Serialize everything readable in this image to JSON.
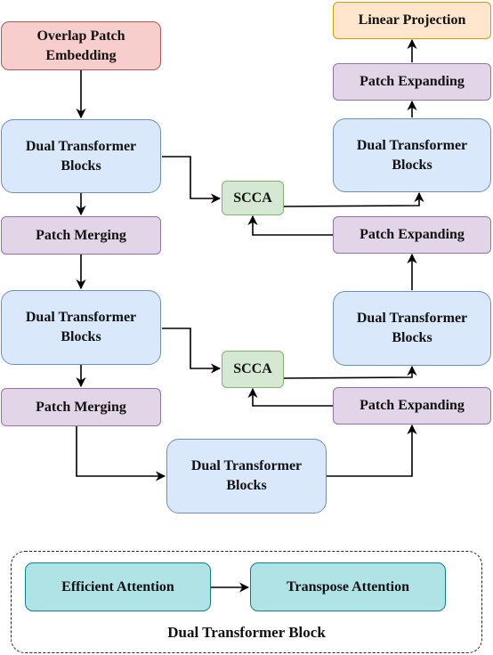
{
  "diagram": {
    "encoder": {
      "embedding": "Overlap Patch Embedding",
      "dtb1": "Dual Transformer Blocks",
      "merge1": "Patch Merging",
      "dtb2": "Dual Transformer Blocks",
      "merge2": "Patch Merging"
    },
    "bottleneck": "Dual Transformer Blocks",
    "skip": {
      "scca1": "SCCA",
      "scca2": "SCCA"
    },
    "decoder": {
      "projection": "Linear Projection",
      "expand_top": "Patch Expanding",
      "dtb_top": "Dual Transformer Blocks",
      "expand_mid": "Patch Expanding",
      "dtb_mid": "Dual Transformer Blocks",
      "expand_low": "Patch Expanding"
    },
    "legend": {
      "efficient": "Efficient Attention",
      "transpose": "Transpose Attention",
      "caption": "Dual Transformer Block"
    }
  },
  "colors": {
    "embedding": "#f8cecc",
    "transformer": "#dae8fc",
    "merge_expand": "#e1d5e7",
    "scca": "#d5e8d4",
    "projection": "#ffe6cc",
    "attention": "#b0e3e6"
  }
}
